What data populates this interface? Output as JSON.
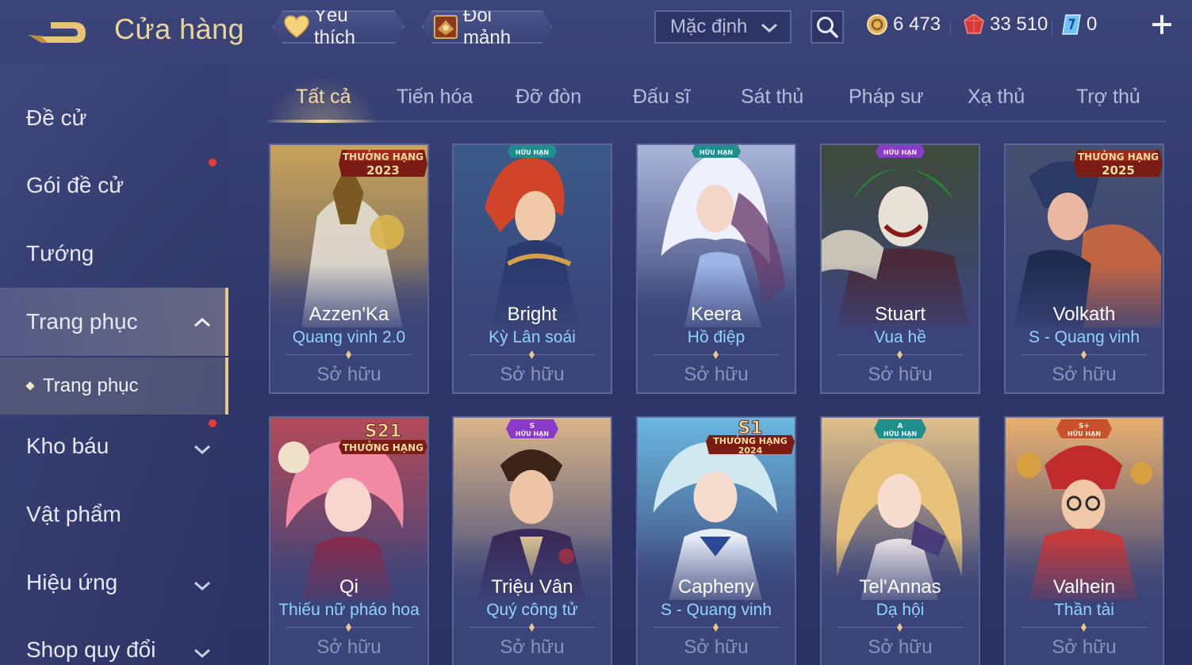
{
  "header": {
    "title": "Cửa hàng",
    "favorite_label": "Yêu thích",
    "exchange_label": "Đổi mảnh",
    "sort_label": "Mặc định",
    "currencies": [
      {
        "name": "gold-coin-icon",
        "value": "6 473"
      },
      {
        "name": "ruby-icon",
        "value": "33 510"
      },
      {
        "name": "voucher-icon",
        "value": "0"
      }
    ]
  },
  "sidebar": {
    "items": [
      {
        "label": "Đề cử"
      },
      {
        "label": "Gói đề cử"
      },
      {
        "label": "Tướng"
      },
      {
        "label": "Trang phục"
      },
      {
        "label": "Trang phục"
      },
      {
        "label": "Kho báu"
      },
      {
        "label": "Vật phẩm"
      },
      {
        "label": "Hiệu ứng"
      },
      {
        "label": "Shop quy đổi"
      }
    ]
  },
  "tabs": [
    {
      "label": "Tất cả"
    },
    {
      "label": "Tiến hóa"
    },
    {
      "label": "Đỡ đòn"
    },
    {
      "label": "Đấu sĩ"
    },
    {
      "label": "Sát thủ"
    },
    {
      "label": "Pháp sư"
    },
    {
      "label": "Xạ thủ"
    },
    {
      "label": "Trợ thủ"
    }
  ],
  "colors": {
    "accent_gold": "#f3dca3",
    "skin_blue": "#8fd3ff",
    "background": "#343d70"
  },
  "cards": [
    {
      "hero": "Azzen'Ka",
      "skin": "Quang vinh 2.0",
      "status": "Sở hữu",
      "badge_top": "THƯỞNG HẠNG",
      "badge_sub": "2023"
    },
    {
      "hero": "Bright",
      "skin": "Kỳ Lân soái",
      "status": "Sở hữu",
      "badge_top": "HỮU HẠN"
    },
    {
      "hero": "Keera",
      "skin": "Hồ điệp",
      "status": "Sở hữu",
      "badge_top": "HỮU HẠN"
    },
    {
      "hero": "Stuart",
      "skin": "Vua hề",
      "status": "Sở hữu",
      "badge_top": "HỮU HẠN"
    },
    {
      "hero": "Volkath",
      "skin": "S - Quang vinh",
      "status": "Sở hữu",
      "badge_top": "THƯỞNG HẠNG",
      "badge_sub": "2025"
    },
    {
      "hero": "Qi",
      "skin": "Thiếu nữ pháo hoa",
      "status": "Sở hữu",
      "badge_grade": "S21",
      "badge_top": "THƯỞNG HẠNG"
    },
    {
      "hero": "Triệu Vân",
      "skin": "Quý công tử",
      "status": "Sở hữu",
      "badge_grade": "S",
      "badge_top": "HỮU HẠN"
    },
    {
      "hero": "Capheny",
      "skin": "S - Quang vinh",
      "status": "Sở hữu",
      "badge_grade": "S1",
      "badge_top": "THƯỞNG HẠNG",
      "badge_sub": "2024"
    },
    {
      "hero": "Tel'Annas",
      "skin": "Dạ hội",
      "status": "Sở hữu",
      "badge_grade": "A",
      "badge_top": "HỮU HẠN"
    },
    {
      "hero": "Valhein",
      "skin": "Thần tài",
      "status": "Sở hữu",
      "badge_grade": "S+",
      "badge_top": "HỮU HẠN"
    }
  ]
}
